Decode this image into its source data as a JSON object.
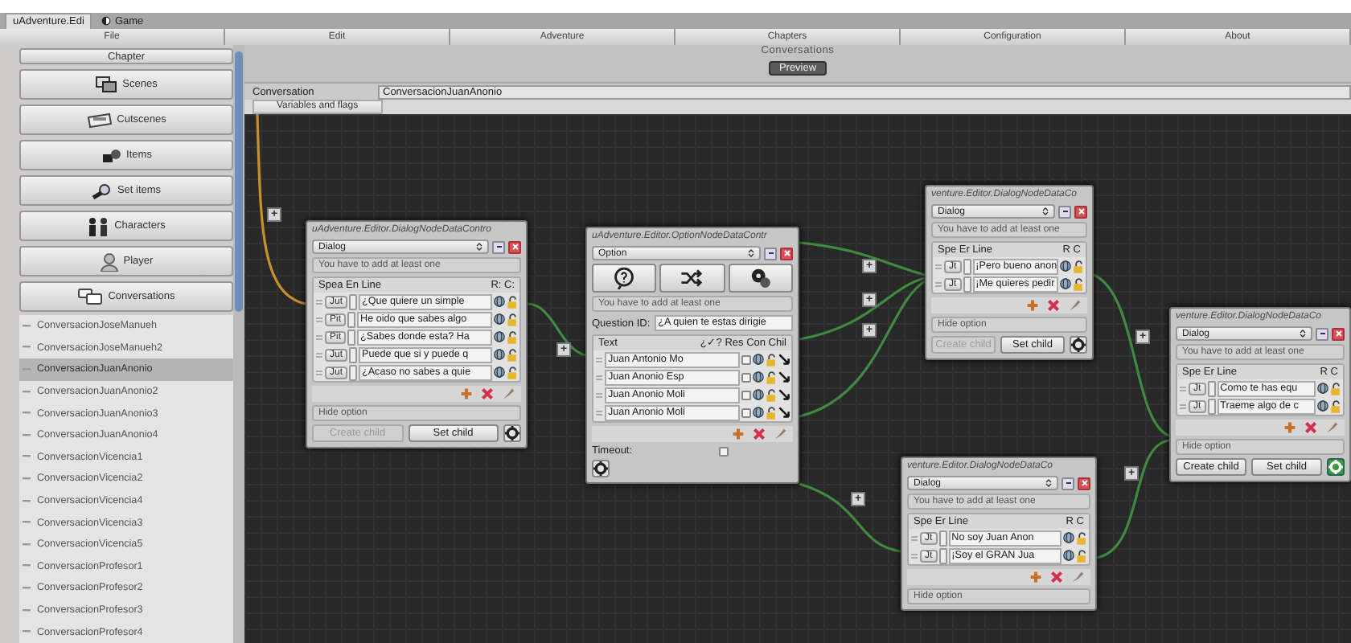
{
  "tabs": [
    {
      "label": "uAdventure.Edi",
      "selected": true
    },
    {
      "label": "Game",
      "selected": false
    }
  ],
  "menu": [
    "File",
    "Edit",
    "Adventure",
    "Chapters",
    "Configuration",
    "About"
  ],
  "sidebar": {
    "chapter_button": "Chapter",
    "sections": [
      {
        "label": "Scenes",
        "selected": false
      },
      {
        "label": "Cutscenes",
        "selected": false
      },
      {
        "label": "Items",
        "selected": false
      },
      {
        "label": "Set items",
        "selected": false
      },
      {
        "label": "Characters",
        "selected": false
      },
      {
        "label": "Player",
        "selected": false
      },
      {
        "label": "Conversations",
        "selected": false
      }
    ],
    "conversations": [
      {
        "label": "ConversacionJoseManueh",
        "selected": false
      },
      {
        "label": "ConversacionJoseManueh2",
        "selected": false
      },
      {
        "label": "ConversacionJuanAnonio",
        "selected": true
      },
      {
        "label": "ConversacionJuanAnonio2",
        "selected": false
      },
      {
        "label": "ConversacionJuanAnonio3",
        "selected": false
      },
      {
        "label": "ConversacionJuanAnonio4",
        "selected": false
      },
      {
        "label": "ConversacionVicencia1",
        "selected": false
      },
      {
        "label": "ConversacionVicencia2",
        "selected": false
      },
      {
        "label": "ConversacionVicencia4",
        "selected": false
      },
      {
        "label": "ConversacionVicencia3",
        "selected": false
      },
      {
        "label": "ConversacionVicencia5",
        "selected": false
      },
      {
        "label": "ConversacionProfesor1",
        "selected": false
      },
      {
        "label": "ConversacionProfesor2",
        "selected": false
      },
      {
        "label": "ConversacionProfesor3",
        "selected": false
      },
      {
        "label": "ConversacionProfesor4",
        "selected": false
      }
    ]
  },
  "main": {
    "title": "Conversations",
    "preview_button": "Preview",
    "conversation_label": "Conversation",
    "conversation_value": "ConversacionJuanAnonio",
    "subtab": "Variables and flags"
  },
  "canvas": {
    "connector_buttons": [
      "+",
      "+",
      "+",
      "+",
      "+",
      "+",
      "+",
      "+"
    ]
  },
  "nodes": [
    {
      "kind": "dialog",
      "title": "uAdventure.Editor.DialogNodeDataContro",
      "type": "Dialog",
      "warning": "You have to add at least one",
      "header_left": "Spea En Line",
      "header_right": "R: C:",
      "lines": [
        {
          "speaker": "Jut",
          "text": "¿Que quiere un simple"
        },
        {
          "speaker": "Pit",
          "text": "He oido que sabes algo"
        },
        {
          "speaker": "Pit",
          "text": "¿Sabes donde esta? Ha"
        },
        {
          "speaker": "Jut",
          "text": "Puede que si y puede q"
        },
        {
          "speaker": "Jut",
          "text": "¿Acaso no sabes a quie"
        }
      ],
      "hide_option": "Hide option",
      "create_child": {
        "label": "Create child",
        "disabled": true
      },
      "set_child": "Set child",
      "selected": false
    },
    {
      "kind": "option",
      "title": "uAdventure.Editor.OptionNodeDataContr",
      "type": "Option",
      "warning": "You have to add at least one",
      "question_label": "Question ID:",
      "question_value": "¿A quien te estas dirigie",
      "header_left": "Text",
      "header_right": "¿✓? Res Con Chil",
      "options": [
        {
          "text": "Juan Antonio Mo",
          "checked": false
        },
        {
          "text": "Juan Anonio Esp",
          "checked": false
        },
        {
          "text": "Juan Anonio Moli",
          "checked": false
        },
        {
          "text": "Juan Anonio Moli",
          "checked": false
        }
      ],
      "timeout_label": "Timeout:",
      "timeout_checked": false,
      "selected": false
    },
    {
      "kind": "dialog",
      "title": "venture.Editor.DialogNodeDataCo",
      "type": "Dialog",
      "warning": "You have to add at least one",
      "header_left": "Spe Er Line",
      "header_right": "R C",
      "lines": [
        {
          "speaker": "Jt",
          "text": "¡Pero bueno anon"
        },
        {
          "speaker": "Jt",
          "text": "¡Me quieres pedir"
        }
      ],
      "hide_option": "Hide option",
      "create_child": {
        "label": "Create child",
        "disabled": true
      },
      "set_child": "Set child",
      "selected": false
    },
    {
      "kind": "dialog",
      "title": "venture.Editor.DialogNodeDataCo",
      "type": "Dialog",
      "warning": "You have to add at least one",
      "header_left": "Spe Er Line",
      "header_right": "R C",
      "lines": [
        {
          "speaker": "Jt",
          "text": "No soy Juan Anon"
        },
        {
          "speaker": "Jt",
          "text": "¡Soy el GRAN Jua"
        }
      ],
      "hide_option": "Hide option"
    },
    {
      "kind": "dialog",
      "title": "venture.Editor.DialogNodeDataCo",
      "type": "Dialog",
      "warning": "You have to add at least one",
      "header_left": "Spe Er Line",
      "header_right": "R C",
      "lines": [
        {
          "speaker": "Jt",
          "text": "Como te has equ"
        },
        {
          "speaker": "Jt",
          "text": "Traeme algo de c"
        }
      ],
      "hide_option": "Hide option",
      "create_child": {
        "label": "Create child",
        "disabled": false
      },
      "set_child": "Set child",
      "selected": true
    }
  ]
}
